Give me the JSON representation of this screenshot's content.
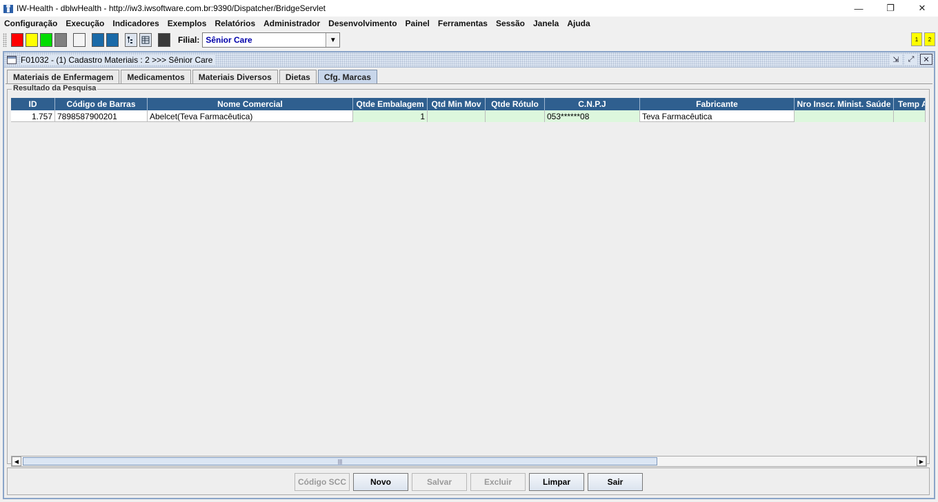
{
  "window": {
    "title": "IW-Health - dblwHealth - http://iw3.iwsoftware.com.br:9390/Dispatcher/BridgeServlet",
    "minimize": "—",
    "restore": "❐",
    "close": "✕"
  },
  "menu": [
    "Configuração",
    "Execução",
    "Indicadores",
    "Exemplos",
    "Relatórios",
    "Administrador",
    "Desenvolvimento",
    "Painel",
    "Ferramentas",
    "Sessão",
    "Janela",
    "Ajuda"
  ],
  "toolbar": {
    "swatches": [
      "#ff0000",
      "#ffff00",
      "#00dd00",
      "#808080",
      "#f4f4f4",
      "#1a6aa8",
      "#1a6aa8"
    ],
    "filial_label": "Filial:",
    "filial_value": "Sênior Care",
    "workspaces": [
      "1",
      "2"
    ]
  },
  "frame": {
    "title": "F01032 - (1) Cadastro Materiais : 2 >>> Sênior Care",
    "tabs": [
      "Materiais de Enfermagem",
      "Medicamentos",
      "Materiais Diversos",
      "Dietas",
      "Cfg. Marcas"
    ],
    "active_tab": "Cfg. Marcas",
    "group_title": "Resultado da Pesquisa"
  },
  "table": {
    "columns": [
      "ID",
      "Código de Barras",
      "Nome Comercial",
      "Qtde Embalagem",
      "Qtd Min Mov",
      "Qtde Rótulo",
      "C.N.P.J",
      "Fabricante",
      "Nro Inscr. Minist. Saúde",
      "Temp A"
    ],
    "rows": [
      [
        "1.757",
        "7898587900201",
        "Abelcet(Teva Farmacêutica)",
        "1",
        "",
        "",
        "053******08",
        "Teva Farmacêutica",
        "",
        ""
      ]
    ]
  },
  "buttons": {
    "codigo_scc": "Código SCC",
    "novo": "Novo",
    "salvar": "Salvar",
    "excluir": "Excluir",
    "limpar": "Limpar",
    "sair": "Sair"
  }
}
